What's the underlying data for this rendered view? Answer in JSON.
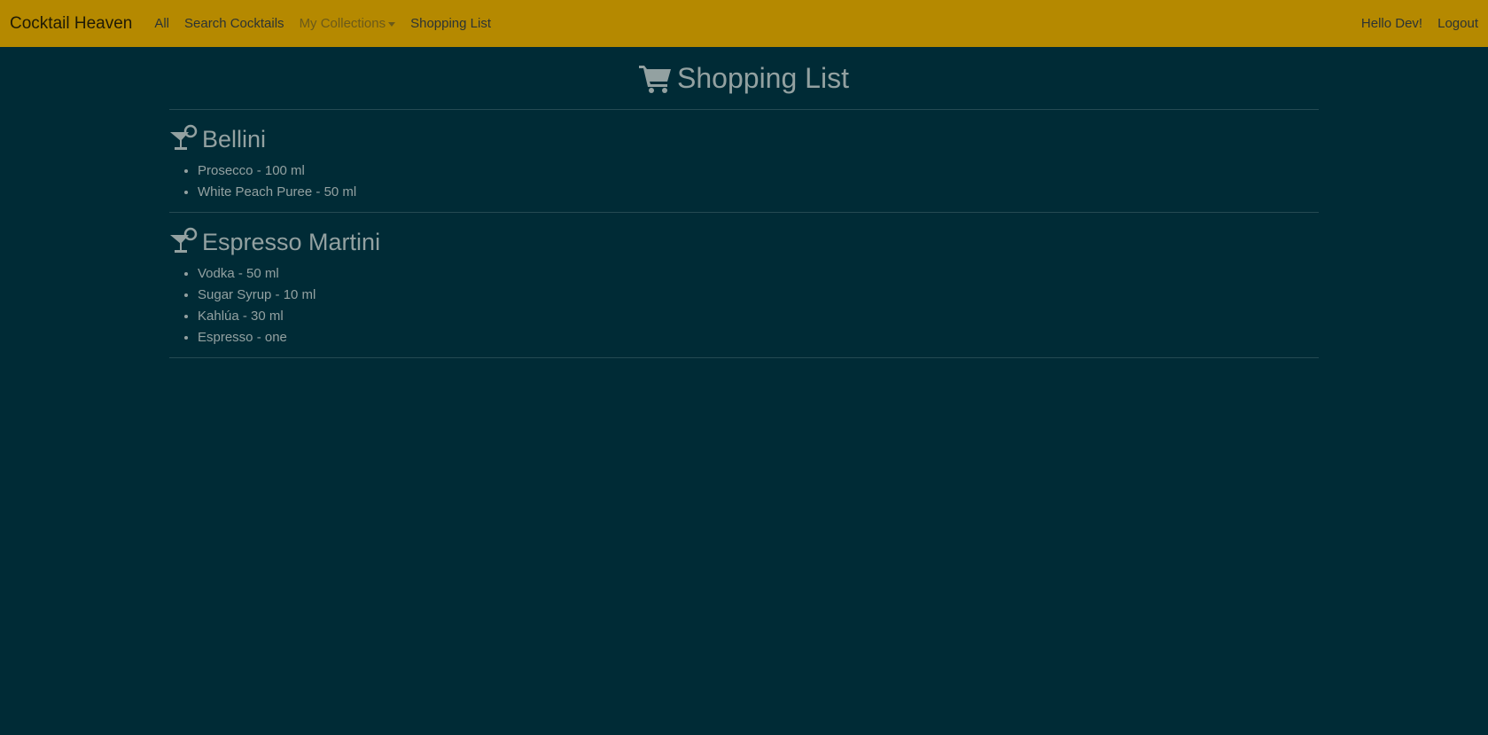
{
  "navbar": {
    "brand": "Cocktail Heaven",
    "links": {
      "all": "All",
      "search": "Search Cocktails",
      "collections": "My Collections",
      "shopping": "Shopping List"
    },
    "user": {
      "greeting": "Hello Dev!",
      "logout": "Logout"
    }
  },
  "page": {
    "title": "Shopping List",
    "icon": "shopping-cart-icon"
  },
  "cocktails": [
    {
      "name": "Bellini",
      "icon": "cocktail-glass-icon",
      "ingredients": [
        "Prosecco - 100 ml",
        "White Peach Puree - 50 ml"
      ]
    },
    {
      "name": "Espresso Martini",
      "icon": "cocktail-glass-icon",
      "ingredients": [
        "Vodka - 50 ml",
        "Sugar Syrup - 10 ml",
        "Kahlúa - 30 ml",
        "Espresso - one"
      ]
    }
  ],
  "colors": {
    "navbar": "#b58900",
    "background": "#002b36",
    "text": "#93a1a1"
  }
}
